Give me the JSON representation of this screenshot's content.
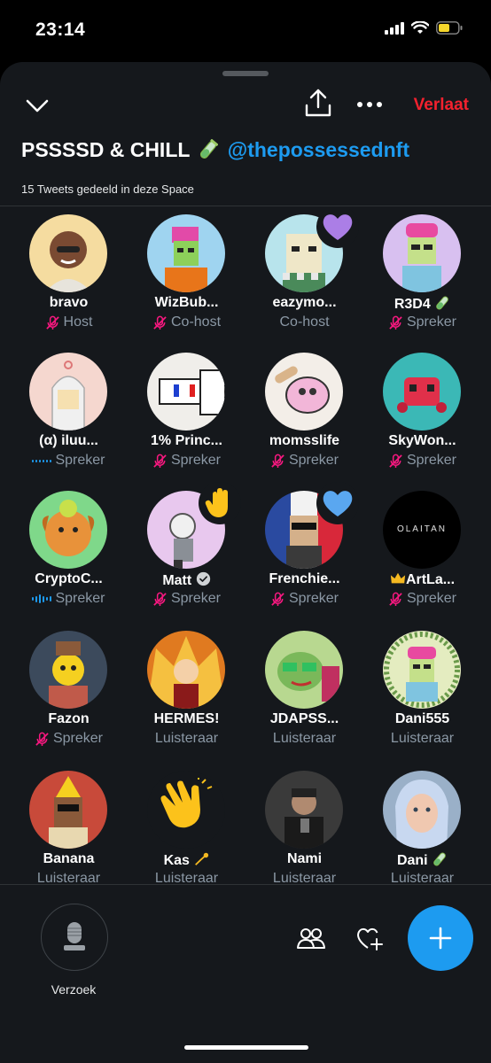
{
  "status_bar": {
    "time": "23:14"
  },
  "header": {
    "leave_label": "Verlaat",
    "title_main": "PSSSSD & CHILL",
    "title_handle": "@thepossessednft",
    "subtitle": "15 Tweets gedeeld in deze Space"
  },
  "participants": [
    {
      "name": "bravo",
      "role": "Host",
      "mic": "muted",
      "avatar_color": "#f5dca0"
    },
    {
      "name": "WizBub...",
      "role": "Co-host",
      "mic": "muted",
      "avatar_color": "#9fd4f0"
    },
    {
      "name": "eazymo...",
      "role": "Co-host",
      "mic": "none",
      "avatar_color": "#b8e4ec",
      "reaction": "purple-heart"
    },
    {
      "name": "R3D4",
      "role": "Spreker",
      "mic": "muted",
      "avatar_color": "#d8c0f0"
    },
    {
      "name": "(α) iluu...",
      "role": "Spreker",
      "mic": "speaking",
      "avatar_color": "#f5d7cf"
    },
    {
      "name": "1% Princ...",
      "role": "Spreker",
      "mic": "muted",
      "avatar_color": "#f0eeea"
    },
    {
      "name": "momsslife",
      "role": "Spreker",
      "mic": "muted",
      "avatar_color": "#f3eee8"
    },
    {
      "name": "SkyWon...",
      "role": "Spreker",
      "mic": "muted",
      "avatar_color": "#3bb8b6"
    },
    {
      "name": "CryptoC...",
      "role": "Spreker",
      "mic": "speaking",
      "avatar_color": "#7fd88a"
    },
    {
      "name": "Matt",
      "role": "Spreker",
      "mic": "muted",
      "avatar_color": "#e8c8ee",
      "verified": true,
      "reaction": "raised-hand"
    },
    {
      "name": "Frenchie...",
      "role": "Spreker",
      "mic": "muted",
      "avatar_color": "#2a4aa0",
      "reaction": "blue-heart"
    },
    {
      "name": "ArtLa...",
      "role": "Spreker",
      "mic": "muted",
      "avatar_color": "#000000",
      "avatar_text": "OLAITAN",
      "crown": true
    },
    {
      "name": "Fazon",
      "role": "Spreker",
      "mic": "muted",
      "avatar_color": "#3c4a5c"
    },
    {
      "name": "HERMES!",
      "role": "Luisteraar",
      "mic": "none",
      "avatar_color": "#e07a20"
    },
    {
      "name": "JDAPSS...",
      "role": "Luisteraar",
      "mic": "none",
      "avatar_color": "#b8d890"
    },
    {
      "name": "Dani555",
      "role": "Luisteraar",
      "mic": "none",
      "avatar_color": "#e4ecc0"
    },
    {
      "name": "Banana",
      "role": "Luisteraar",
      "mic": "none",
      "avatar_color": "#c84a3a"
    },
    {
      "name": "Kas",
      "role": "Luisteraar",
      "mic": "none",
      "avatar_color": "#15181c",
      "reaction": "clapping",
      "name_suffix_icon": "dizzy"
    },
    {
      "name": "Nami",
      "role": "Luisteraar",
      "mic": "none",
      "avatar_color": "#3a3a3a"
    },
    {
      "name": "Dani",
      "role": "Luisteraar",
      "mic": "none",
      "avatar_color": "#9ab0c8",
      "name_suffix_icon": "test-tube"
    }
  ],
  "bottom": {
    "request_label": "Verzoek"
  },
  "colors": {
    "accent": "#1d9bf0",
    "leave": "#f4212e",
    "muted": "#f91880",
    "secondary_text": "#8b98a5"
  }
}
